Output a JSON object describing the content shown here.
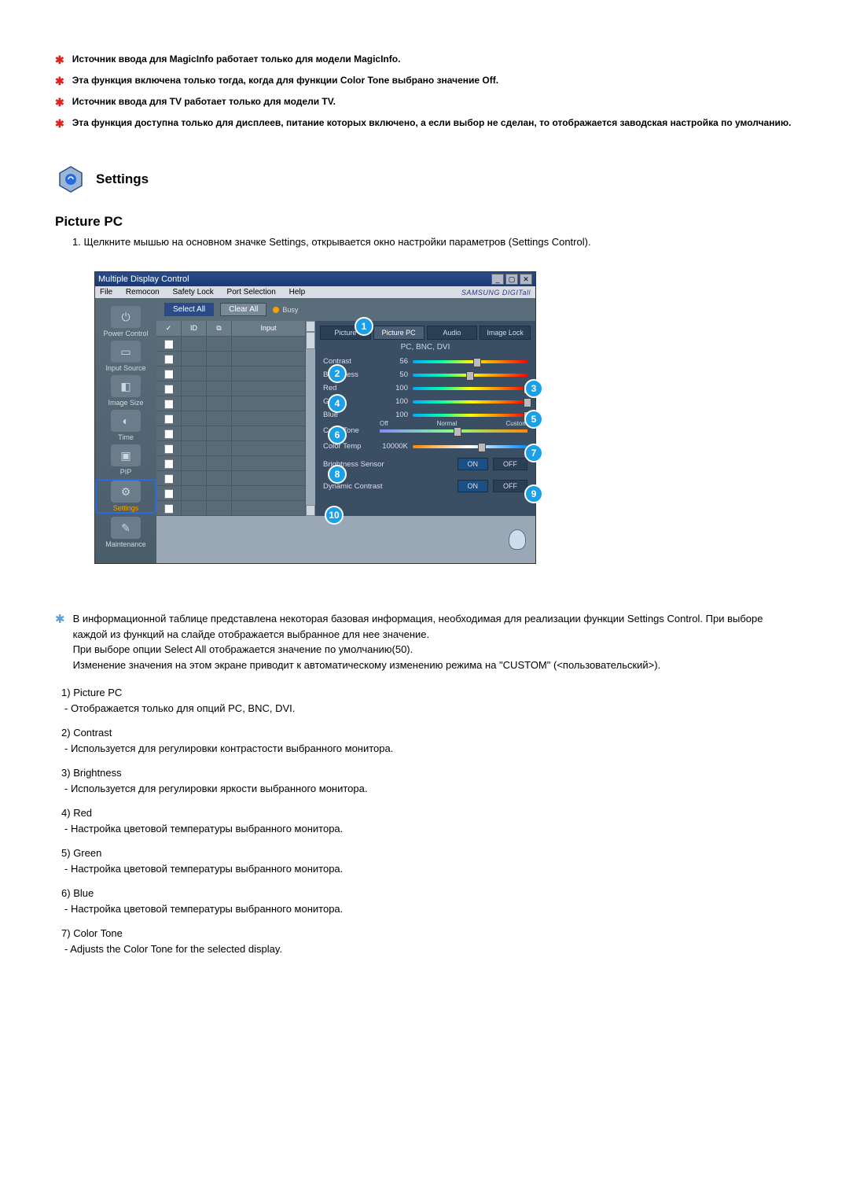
{
  "notes": [
    "Источник ввода для MagicInfo работает только для модели MagicInfo.",
    "Эта функция включена только тогда, когда для функции Color Tone выбрано значение Off.",
    "Источник ввода для TV работает только для модели TV.",
    "Эта функция доступна только для дисплеев, питание которых включено, а если выбор не сделан, то отображается заводская настройка по умолчанию."
  ],
  "settings_title": "Settings",
  "section_title": "Picture PC",
  "step1": "1.  Щелкните мышью на основном значке Settings, открывается окно настройки параметров (Settings Control).",
  "app": {
    "title": "Multiple Display Control",
    "menus": [
      "File",
      "Remocon",
      "Safety Lock",
      "Port Selection",
      "Help"
    ],
    "logo": "SAMSUNG DIGITall",
    "sidebar": [
      {
        "label": "Power Control"
      },
      {
        "label": "Input Source"
      },
      {
        "label": "Image Size"
      },
      {
        "label": "Time"
      },
      {
        "label": "PIP"
      },
      {
        "label": "Settings",
        "active": true
      },
      {
        "label": "Maintenance"
      }
    ],
    "select_all": "Select All",
    "clear_all": "Clear All",
    "busy": "Busy",
    "grid_headers": [
      "✓",
      "ID",
      "⧉",
      "Input"
    ],
    "tabs": [
      "Picture",
      "Picture PC",
      "Audio",
      "Image Lock"
    ],
    "mode_line": "PC, BNC, DVI",
    "controls": [
      {
        "label": "Contrast",
        "value": "56",
        "pct": 56
      },
      {
        "label": "Brightness",
        "value": "50",
        "pct": 50
      },
      {
        "label": "Red",
        "value": "100",
        "pct": 100
      },
      {
        "label": "Green",
        "value": "100",
        "pct": 100
      },
      {
        "label": "Blue",
        "value": "100",
        "pct": 100
      }
    ],
    "color_tone_label": "Color Tone",
    "color_tone_opts": [
      "Off",
      "Normal",
      "Custom"
    ],
    "color_temp_label": "Color Temp",
    "color_temp_value": "10000K",
    "brightness_sensor_label": "Brightness Sensor",
    "dynamic_contrast_label": "Dynamic Contrast",
    "on": "ON",
    "off": "OFF"
  },
  "callouts": [
    "1",
    "2",
    "3",
    "4",
    "5",
    "6",
    "7",
    "8",
    "9",
    "10"
  ],
  "footnote": "В информационной таблице представлена некоторая базовая информация, необходимая для реализации функции Settings Control. При выборе каждой из функций на слайде отображается выбранное для нее значение.\nПри выборе опции Select All отображается значение по умолчанию(50).\nИзменение значения на этом экране приводит к автоматическому изменению режима на \"CUSTOM\" (<пользовательский>).",
  "numbered": [
    {
      "num": "1)",
      "title": "Picture PC",
      "desc": "- Отображается только для опций PC, BNC, DVI."
    },
    {
      "num": "2)",
      "title": "Contrast",
      "desc": "- Используется для регулировки контрастости выбранного монитора."
    },
    {
      "num": "3)",
      "title": "Brightness",
      "desc": "- Используется для регулировки яркости выбранного монитора."
    },
    {
      "num": "4)",
      "title": "Red",
      "desc": "- Настройка цветовой температуры выбранного монитора."
    },
    {
      "num": "5)",
      "title": "Green",
      "desc": "- Настройка цветовой температуры выбранного монитора."
    },
    {
      "num": "6)",
      "title": "Blue",
      "desc": "- Настройка цветовой температуры выбранного монитора."
    },
    {
      "num": "7)",
      "title": "Color Tone",
      "desc": "- Adjusts the Color Tone for the selected display."
    }
  ]
}
